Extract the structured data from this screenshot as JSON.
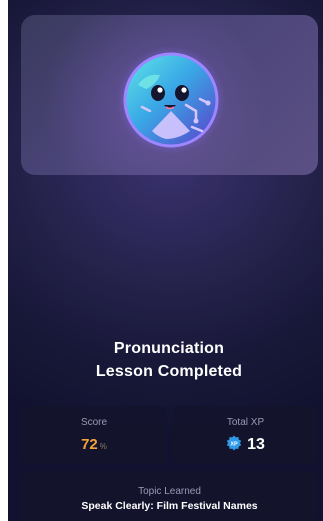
{
  "title": {
    "line1": "Pronunciation",
    "line2": "Lesson Completed"
  },
  "stats": {
    "score_label": "Score",
    "score_value": "72",
    "score_unit": "%",
    "xp_label": "Total XP",
    "xp_value": "13",
    "xp_badge_text": "XP"
  },
  "topic": {
    "label": "Topic Learned",
    "value": "Speak Clearly: Film Festival Names"
  },
  "colors": {
    "score_accent": "#f5a33a",
    "xp_badge": "#2f9ae8",
    "background": "#1b1b3e"
  },
  "icons": {
    "hero": "planet-mascot-icon",
    "xp": "xp-badge-icon"
  }
}
